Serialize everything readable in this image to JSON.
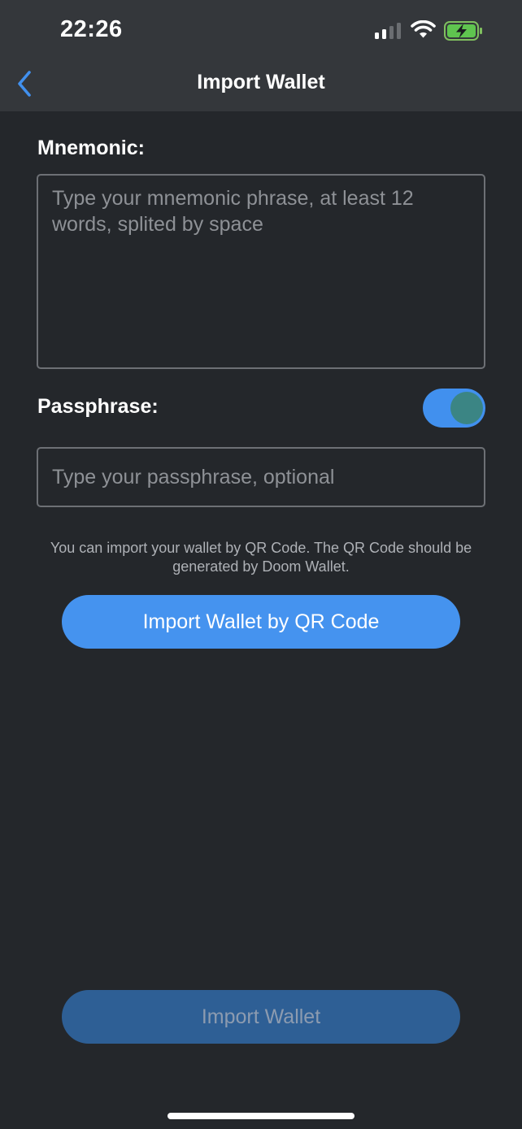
{
  "status_bar": {
    "time": "22:26",
    "signal_icon": "cellular-signal-icon",
    "wifi_icon": "wifi-icon",
    "battery_icon": "battery-charging-icon"
  },
  "nav": {
    "back_icon": "chevron-left-icon",
    "title": "Import Wallet"
  },
  "mnemonic": {
    "label": "Mnemonic:",
    "value": "",
    "placeholder": "Type your mnemonic phrase, at least 12 words, splited by space"
  },
  "passphrase": {
    "label": "Passphrase:",
    "toggle_on": true,
    "value": "",
    "placeholder": "Type your passphrase, optional"
  },
  "qr": {
    "info": "You can import your wallet by QR Code. The QR Code should be generated by Doom Wallet.",
    "button_label": "Import Wallet by QR Code"
  },
  "footer": {
    "import_button_label": "Import Wallet"
  },
  "colors": {
    "background": "#24272b",
    "header": "#34373b",
    "accent": "#4593ef",
    "toggle_on": "#4190ee",
    "toggle_knob": "#3b8584",
    "disabled_button": "#2e5f95",
    "placeholder_text": "#8e9196"
  }
}
